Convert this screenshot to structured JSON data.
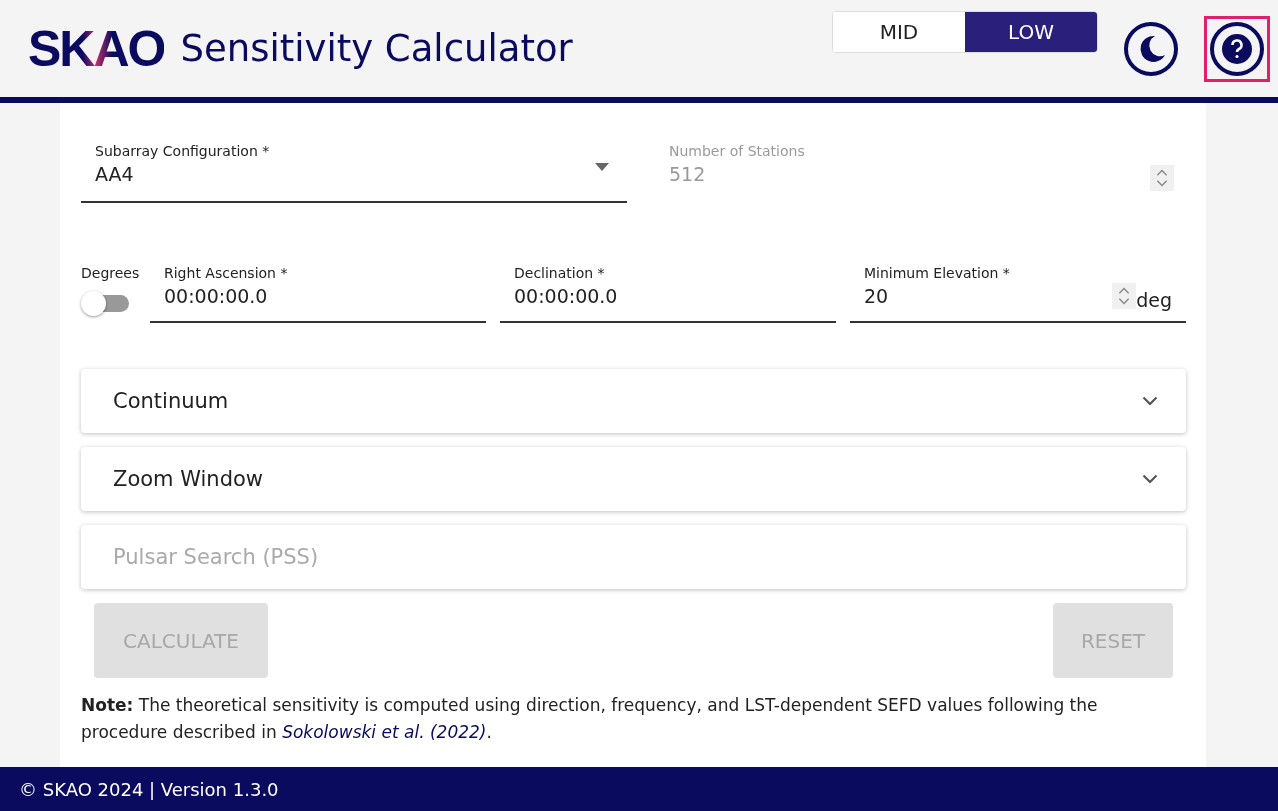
{
  "header": {
    "logo": "SKAO",
    "title": "Sensitivity Calculator",
    "telescopes": [
      {
        "label": "MID",
        "selected": false
      },
      {
        "label": "LOW",
        "selected": true
      }
    ],
    "help_highlighted": true
  },
  "subarray": {
    "label": "Subarray Configuration *",
    "value": "AA4"
  },
  "stations": {
    "label": "Number of Stations",
    "value": "512",
    "disabled": true
  },
  "degrees": {
    "label": "Degrees",
    "on": false
  },
  "coords": [
    {
      "label": "Right Ascension *",
      "value": "00:00:00.0"
    },
    {
      "label": "Declination *",
      "value": "00:00:00.0"
    }
  ],
  "elevation": {
    "label": "Minimum Elevation *",
    "value": "20",
    "unit": "deg"
  },
  "sections": [
    {
      "title": "Continuum",
      "disabled": false
    },
    {
      "title": "Zoom Window",
      "disabled": false
    },
    {
      "title": "Pulsar Search (PSS)",
      "disabled": true
    }
  ],
  "buttons": [
    {
      "label": "CALCULATE",
      "disabled": true
    },
    {
      "label": "RESET",
      "disabled": true
    }
  ],
  "note": {
    "text": "**Note:** The theoretical sensitivity is computed using direction, frequency, and LST-dependent SEFD values following the procedure described in ",
    "link": "Sokolowski et al. (2022)",
    "after": "."
  },
  "footer": "© SKAO 2024 | Version 1.3.0"
}
